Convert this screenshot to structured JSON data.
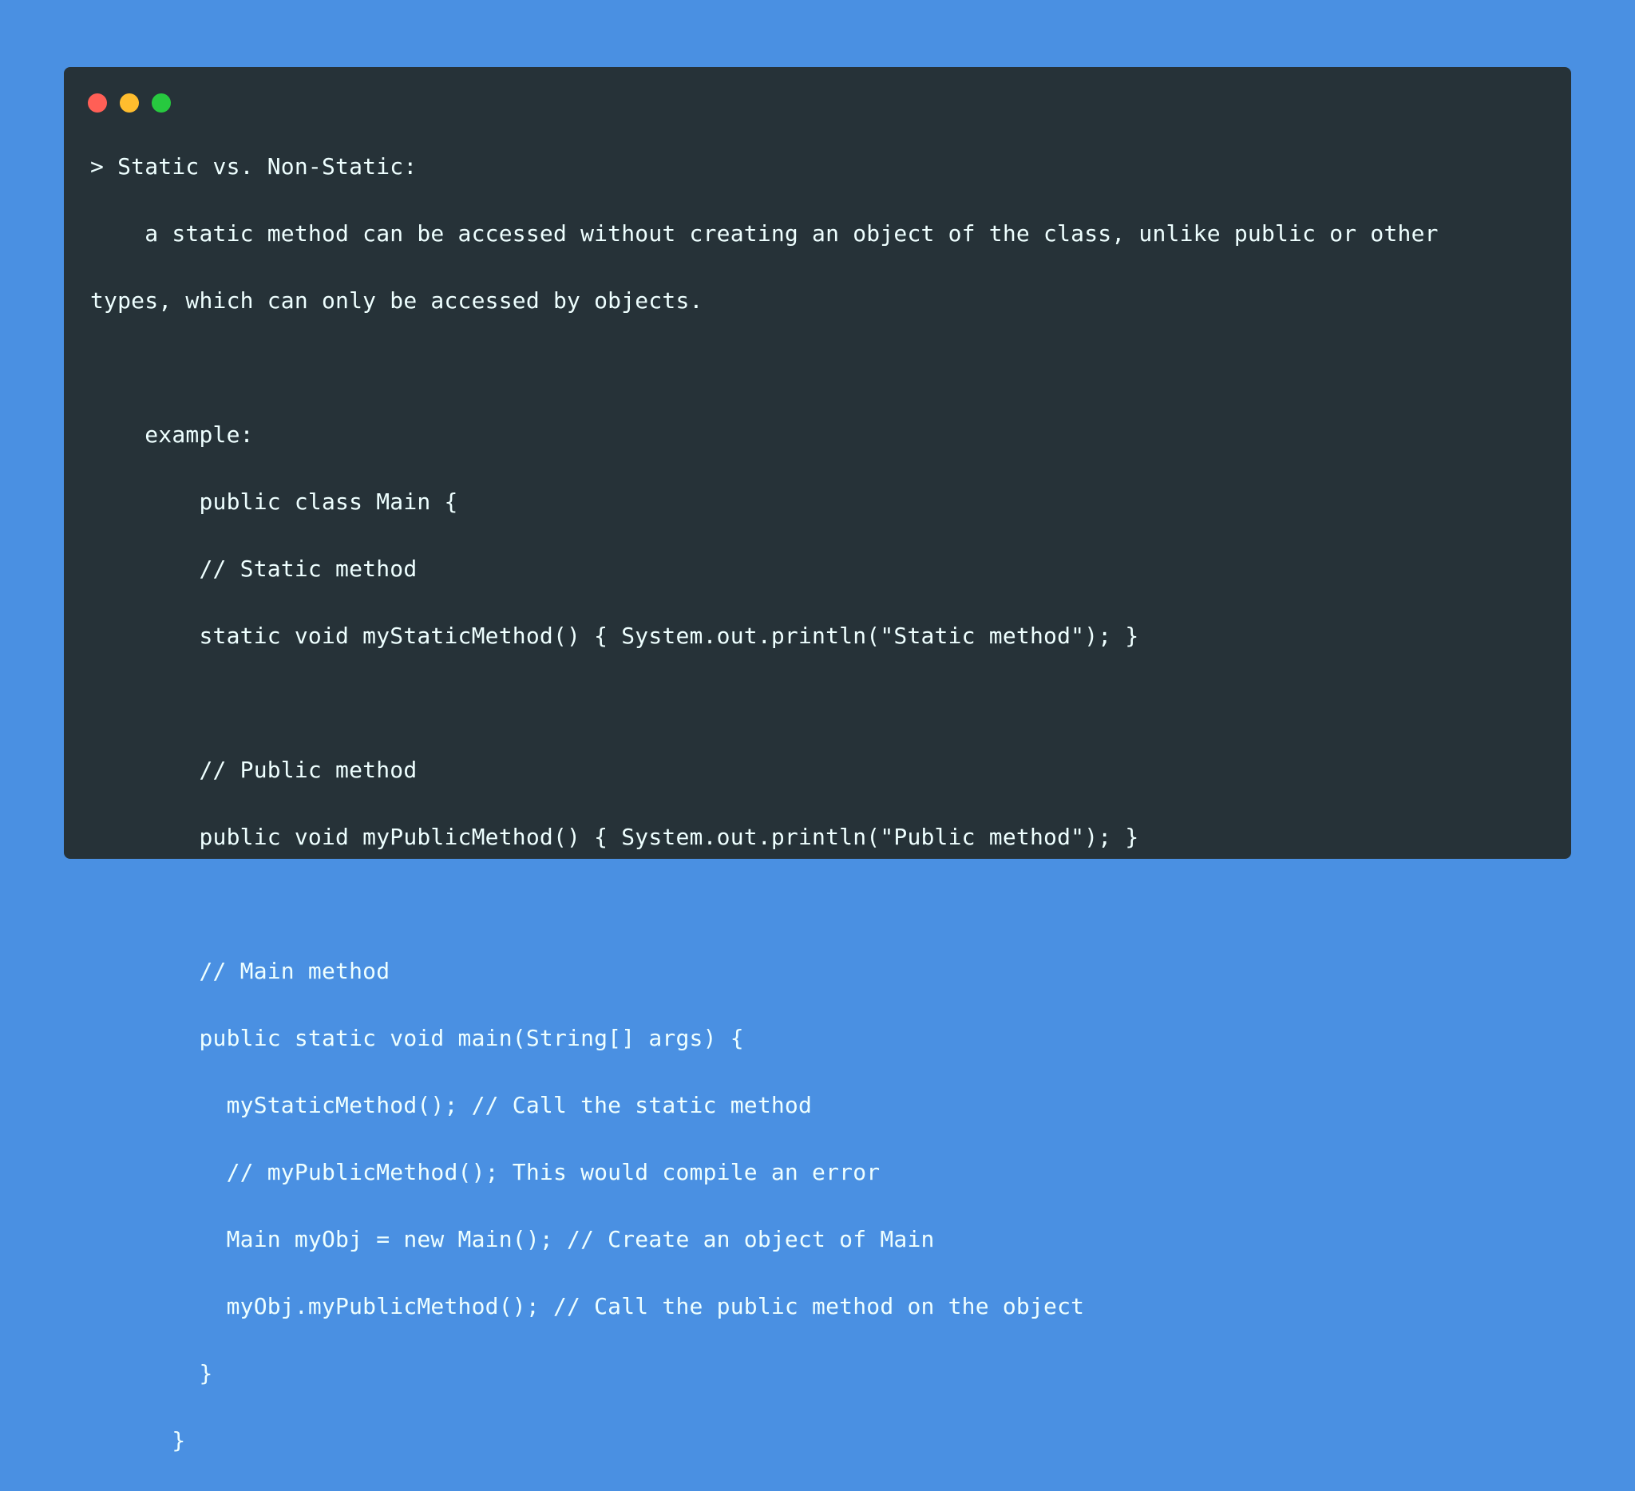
{
  "window": {
    "controls": [
      {
        "name": "close",
        "color": "#ff5f56",
        "icon": "close-dot-icon"
      },
      {
        "name": "minimize",
        "color": "#ffbd2e",
        "icon": "minimize-dot-icon"
      },
      {
        "name": "maximize",
        "color": "#27c93f",
        "icon": "maximize-dot-icon"
      }
    ],
    "background": "#263238",
    "page_background": "#4a90e2"
  },
  "code": {
    "lines": [
      "> Static vs. Non-Static:",
      "    a static method can be accessed without creating an object of the class, unlike public or other",
      "types, which can only be accessed by objects.",
      "",
      "    example:",
      "        public class Main {",
      "        // Static method",
      "        static void myStaticMethod() { System.out.println(\"Static method\"); }",
      "",
      "        // Public method",
      "        public void myPublicMethod() { System.out.println(\"Public method\"); }",
      "",
      "        // Main method",
      "        public static void main(String[] args) {",
      "          myStaticMethod(); // Call the static method",
      "          // myPublicMethod(); This would compile an error",
      "          Main myObj = new Main(); // Create an object of Main",
      "          myObj.myPublicMethod(); // Call the public method on the object",
      "        }",
      "      }"
    ]
  }
}
